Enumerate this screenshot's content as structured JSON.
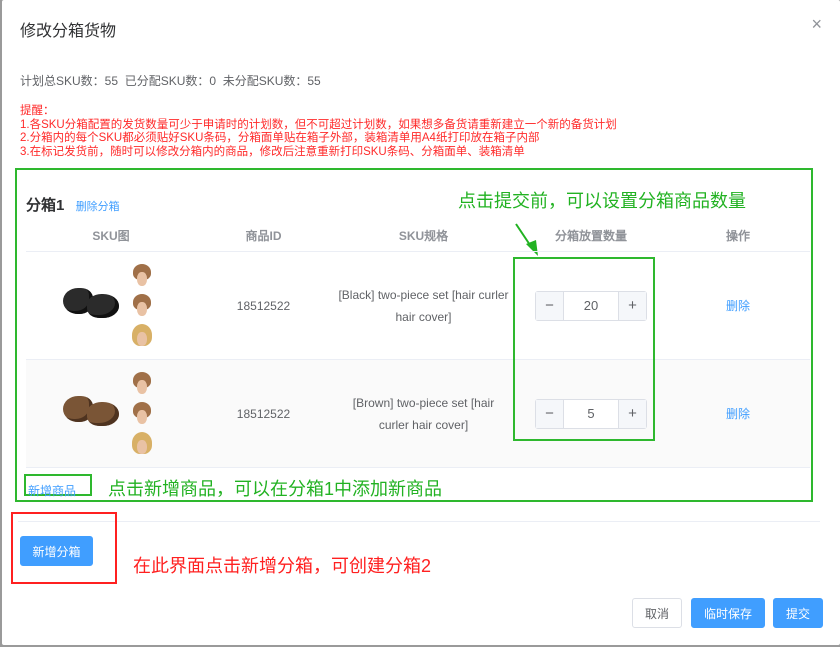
{
  "dialog": {
    "title": "修改分箱货物",
    "close_glyph": "×"
  },
  "summary": "计划总SKU数：55  已分配SKU数：0  未分配SKU数：55",
  "tips": {
    "heading": "提醒：",
    "lines": [
      "1.各SKU分箱配置的发货数量可少于申请时的计划数，但不可超过计划数，如果想多备货请重新建立一个新的备货计划",
      "2.分箱内的每个SKU都必须贴好SKU条码，分箱面单贴在箱子外部，装箱清单用A4纸打印放在箱子内部",
      "3.在标记发货前，随时可以修改分箱内的商品，修改后注意重新打印SKU条码、分箱面单、装箱清单"
    ]
  },
  "box": {
    "name": "分箱1",
    "delete_label": "删除分箱",
    "columns": [
      "SKU图",
      "商品ID",
      "SKU规格",
      "分箱放置数量",
      "操作"
    ],
    "rows": [
      {
        "product_id": "18512522",
        "spec": "[Black] two-piece set [hair curler hair cover]",
        "quantity": "20",
        "action": "删除"
      },
      {
        "product_id": "18512522",
        "spec": "[Brown] two-piece set [hair curler hair cover]",
        "quantity": "5",
        "action": "删除"
      }
    ],
    "add_item_label": "新增商品"
  },
  "annotations": {
    "qty_hint": "点击提交前，可以设置分箱商品数量",
    "add_item_hint": "点击新增商品，可以在分箱1中添加新商品",
    "add_box_hint": "在此界面点击新增分箱，可创建分箱2"
  },
  "buttons": {
    "add_box": "新增分箱",
    "cancel": "取消",
    "temp_save": "临时保存",
    "submit": "提交"
  },
  "stepper": {
    "minus": "−",
    "plus": "+"
  },
  "colors": {
    "primary": "#409eff",
    "annotation_green": "#22b222",
    "annotation_red": "#ff2020",
    "tip_red": "#ff2a2a"
  },
  "icons": {
    "close": "close-icon",
    "arrow": "arrow-down-icon"
  }
}
